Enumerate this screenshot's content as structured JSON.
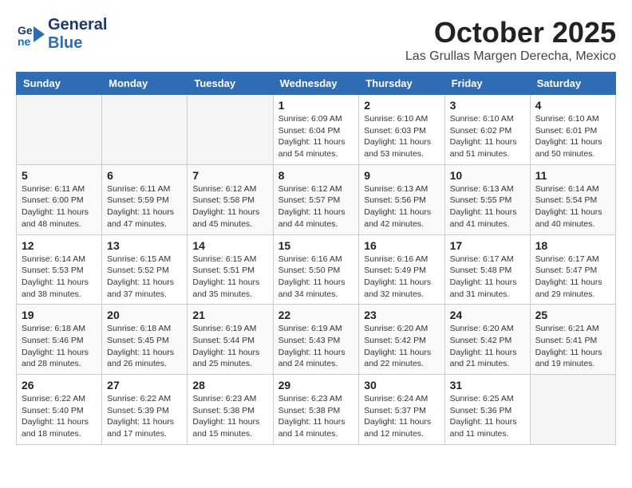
{
  "logo": {
    "line1": "General",
    "line2": "Blue"
  },
  "title": "October 2025",
  "location": "Las Grullas Margen Derecha, Mexico",
  "weekdays": [
    "Sunday",
    "Monday",
    "Tuesday",
    "Wednesday",
    "Thursday",
    "Friday",
    "Saturday"
  ],
  "weeks": [
    [
      {
        "day": "",
        "info": ""
      },
      {
        "day": "",
        "info": ""
      },
      {
        "day": "",
        "info": ""
      },
      {
        "day": "1",
        "info": "Sunrise: 6:09 AM\nSunset: 6:04 PM\nDaylight: 11 hours\nand 54 minutes."
      },
      {
        "day": "2",
        "info": "Sunrise: 6:10 AM\nSunset: 6:03 PM\nDaylight: 11 hours\nand 53 minutes."
      },
      {
        "day": "3",
        "info": "Sunrise: 6:10 AM\nSunset: 6:02 PM\nDaylight: 11 hours\nand 51 minutes."
      },
      {
        "day": "4",
        "info": "Sunrise: 6:10 AM\nSunset: 6:01 PM\nDaylight: 11 hours\nand 50 minutes."
      }
    ],
    [
      {
        "day": "5",
        "info": "Sunrise: 6:11 AM\nSunset: 6:00 PM\nDaylight: 11 hours\nand 48 minutes."
      },
      {
        "day": "6",
        "info": "Sunrise: 6:11 AM\nSunset: 5:59 PM\nDaylight: 11 hours\nand 47 minutes."
      },
      {
        "day": "7",
        "info": "Sunrise: 6:12 AM\nSunset: 5:58 PM\nDaylight: 11 hours\nand 45 minutes."
      },
      {
        "day": "8",
        "info": "Sunrise: 6:12 AM\nSunset: 5:57 PM\nDaylight: 11 hours\nand 44 minutes."
      },
      {
        "day": "9",
        "info": "Sunrise: 6:13 AM\nSunset: 5:56 PM\nDaylight: 11 hours\nand 42 minutes."
      },
      {
        "day": "10",
        "info": "Sunrise: 6:13 AM\nSunset: 5:55 PM\nDaylight: 11 hours\nand 41 minutes."
      },
      {
        "day": "11",
        "info": "Sunrise: 6:14 AM\nSunset: 5:54 PM\nDaylight: 11 hours\nand 40 minutes."
      }
    ],
    [
      {
        "day": "12",
        "info": "Sunrise: 6:14 AM\nSunset: 5:53 PM\nDaylight: 11 hours\nand 38 minutes."
      },
      {
        "day": "13",
        "info": "Sunrise: 6:15 AM\nSunset: 5:52 PM\nDaylight: 11 hours\nand 37 minutes."
      },
      {
        "day": "14",
        "info": "Sunrise: 6:15 AM\nSunset: 5:51 PM\nDaylight: 11 hours\nand 35 minutes."
      },
      {
        "day": "15",
        "info": "Sunrise: 6:16 AM\nSunset: 5:50 PM\nDaylight: 11 hours\nand 34 minutes."
      },
      {
        "day": "16",
        "info": "Sunrise: 6:16 AM\nSunset: 5:49 PM\nDaylight: 11 hours\nand 32 minutes."
      },
      {
        "day": "17",
        "info": "Sunrise: 6:17 AM\nSunset: 5:48 PM\nDaylight: 11 hours\nand 31 minutes."
      },
      {
        "day": "18",
        "info": "Sunrise: 6:17 AM\nSunset: 5:47 PM\nDaylight: 11 hours\nand 29 minutes."
      }
    ],
    [
      {
        "day": "19",
        "info": "Sunrise: 6:18 AM\nSunset: 5:46 PM\nDaylight: 11 hours\nand 28 minutes."
      },
      {
        "day": "20",
        "info": "Sunrise: 6:18 AM\nSunset: 5:45 PM\nDaylight: 11 hours\nand 26 minutes."
      },
      {
        "day": "21",
        "info": "Sunrise: 6:19 AM\nSunset: 5:44 PM\nDaylight: 11 hours\nand 25 minutes."
      },
      {
        "day": "22",
        "info": "Sunrise: 6:19 AM\nSunset: 5:43 PM\nDaylight: 11 hours\nand 24 minutes."
      },
      {
        "day": "23",
        "info": "Sunrise: 6:20 AM\nSunset: 5:42 PM\nDaylight: 11 hours\nand 22 minutes."
      },
      {
        "day": "24",
        "info": "Sunrise: 6:20 AM\nSunset: 5:42 PM\nDaylight: 11 hours\nand 21 minutes."
      },
      {
        "day": "25",
        "info": "Sunrise: 6:21 AM\nSunset: 5:41 PM\nDaylight: 11 hours\nand 19 minutes."
      }
    ],
    [
      {
        "day": "26",
        "info": "Sunrise: 6:22 AM\nSunset: 5:40 PM\nDaylight: 11 hours\nand 18 minutes."
      },
      {
        "day": "27",
        "info": "Sunrise: 6:22 AM\nSunset: 5:39 PM\nDaylight: 11 hours\nand 17 minutes."
      },
      {
        "day": "28",
        "info": "Sunrise: 6:23 AM\nSunset: 5:38 PM\nDaylight: 11 hours\nand 15 minutes."
      },
      {
        "day": "29",
        "info": "Sunrise: 6:23 AM\nSunset: 5:38 PM\nDaylight: 11 hours\nand 14 minutes."
      },
      {
        "day": "30",
        "info": "Sunrise: 6:24 AM\nSunset: 5:37 PM\nDaylight: 11 hours\nand 12 minutes."
      },
      {
        "day": "31",
        "info": "Sunrise: 6:25 AM\nSunset: 5:36 PM\nDaylight: 11 hours\nand 11 minutes."
      },
      {
        "day": "",
        "info": ""
      }
    ]
  ]
}
